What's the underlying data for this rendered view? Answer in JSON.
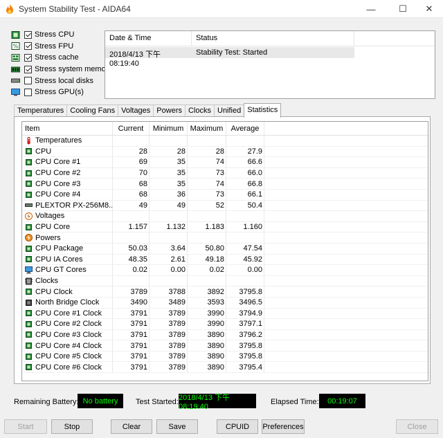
{
  "window": {
    "title": "System Stability Test - AIDA64",
    "min_symbol": "—",
    "max_symbol": "☐",
    "close_symbol": "✕"
  },
  "options": [
    {
      "label": "Stress CPU",
      "checked": true,
      "icon": "cpu-icon"
    },
    {
      "label": "Stress FPU",
      "checked": true,
      "icon": "fpu-icon"
    },
    {
      "label": "Stress cache",
      "checked": true,
      "icon": "cache-icon"
    },
    {
      "label": "Stress system memory",
      "checked": true,
      "icon": "memory-icon"
    },
    {
      "label": "Stress local disks",
      "checked": false,
      "icon": "disk-icon"
    },
    {
      "label": "Stress GPU(s)",
      "checked": false,
      "icon": "gpu-icon"
    }
  ],
  "log": {
    "col_datetime": "Date & Time",
    "col_status": "Status",
    "rows": [
      {
        "datetime": "2018/4/13 下午 08:19:40",
        "status": "Stability Test: Started"
      }
    ]
  },
  "tabs": [
    "Temperatures",
    "Cooling Fans",
    "Voltages",
    "Powers",
    "Clocks",
    "Unified",
    "Statistics"
  ],
  "active_tab": "Statistics",
  "stats": {
    "headers": {
      "item": "Item",
      "current": "Current",
      "minimum": "Minimum",
      "maximum": "Maximum",
      "average": "Average"
    },
    "rows": [
      {
        "type": "cat",
        "icon": "thermometer-icon",
        "item": "Temperatures"
      },
      {
        "type": "sub",
        "icon": "cpu-chip-icon",
        "item": "CPU",
        "current": "28",
        "minimum": "28",
        "maximum": "28",
        "average": "27.9"
      },
      {
        "type": "sub",
        "icon": "cpu-chip-icon",
        "item": "CPU Core #1",
        "current": "69",
        "minimum": "35",
        "maximum": "74",
        "average": "66.6"
      },
      {
        "type": "sub",
        "icon": "cpu-chip-icon",
        "item": "CPU Core #2",
        "current": "70",
        "minimum": "35",
        "maximum": "73",
        "average": "66.0"
      },
      {
        "type": "sub",
        "icon": "cpu-chip-icon",
        "item": "CPU Core #3",
        "current": "68",
        "minimum": "35",
        "maximum": "74",
        "average": "66.8"
      },
      {
        "type": "sub",
        "icon": "cpu-chip-icon",
        "item": "CPU Core #4",
        "current": "68",
        "minimum": "36",
        "maximum": "73",
        "average": "66.1"
      },
      {
        "type": "sub",
        "icon": "drive-icon",
        "item": "PLEXTOR PX-256M8...",
        "current": "49",
        "minimum": "49",
        "maximum": "52",
        "average": "50.4"
      },
      {
        "type": "cat",
        "icon": "voltage-icon",
        "item": "Voltages"
      },
      {
        "type": "sub",
        "icon": "cpu-chip-icon",
        "item": "CPU Core",
        "current": "1.157",
        "minimum": "1.132",
        "maximum": "1.183",
        "average": "1.160"
      },
      {
        "type": "cat",
        "icon": "power-icon",
        "item": "Powers"
      },
      {
        "type": "sub",
        "icon": "cpu-chip-icon",
        "item": "CPU Package",
        "current": "50.03",
        "minimum": "3.64",
        "maximum": "50.80",
        "average": "47.54"
      },
      {
        "type": "sub",
        "icon": "cpu-chip-icon",
        "item": "CPU IA Cores",
        "current": "48.35",
        "minimum": "2.61",
        "maximum": "49.18",
        "average": "45.92"
      },
      {
        "type": "sub",
        "icon": "monitor-icon",
        "item": "CPU GT Cores",
        "current": "0.02",
        "minimum": "0.00",
        "maximum": "0.02",
        "average": "0.00"
      },
      {
        "type": "cat",
        "icon": "clock-icon",
        "item": "Clocks"
      },
      {
        "type": "sub",
        "icon": "cpu-chip-icon",
        "item": "CPU Clock",
        "current": "3789",
        "minimum": "3788",
        "maximum": "3892",
        "average": "3795.8"
      },
      {
        "type": "sub",
        "icon": "chipset-icon",
        "item": "North Bridge Clock",
        "current": "3490",
        "minimum": "3489",
        "maximum": "3593",
        "average": "3496.5"
      },
      {
        "type": "sub",
        "icon": "cpu-chip-icon",
        "item": "CPU Core #1 Clock",
        "current": "3791",
        "minimum": "3789",
        "maximum": "3990",
        "average": "3794.9"
      },
      {
        "type": "sub",
        "icon": "cpu-chip-icon",
        "item": "CPU Core #2 Clock",
        "current": "3791",
        "minimum": "3789",
        "maximum": "3990",
        "average": "3797.1"
      },
      {
        "type": "sub",
        "icon": "cpu-chip-icon",
        "item": "CPU Core #3 Clock",
        "current": "3791",
        "minimum": "3789",
        "maximum": "3890",
        "average": "3796.2"
      },
      {
        "type": "sub",
        "icon": "cpu-chip-icon",
        "item": "CPU Core #4 Clock",
        "current": "3791",
        "minimum": "3789",
        "maximum": "3890",
        "average": "3795.8"
      },
      {
        "type": "sub",
        "icon": "cpu-chip-icon",
        "item": "CPU Core #5 Clock",
        "current": "3791",
        "minimum": "3789",
        "maximum": "3890",
        "average": "3795.8"
      },
      {
        "type": "sub",
        "icon": "cpu-chip-icon",
        "item": "CPU Core #6 Clock",
        "current": "3791",
        "minimum": "3789",
        "maximum": "3890",
        "average": "3795.4"
      }
    ]
  },
  "status": {
    "battery_label": "Remaining Battery:",
    "battery_value": "No battery",
    "started_label": "Test Started:",
    "started_value": "2018/4/13 下午 08:19:40",
    "elapsed_label": "Elapsed Time:",
    "elapsed_value": "00:19:07"
  },
  "buttons": {
    "start": "Start",
    "stop": "Stop",
    "clear": "Clear",
    "save": "Save",
    "cpuid": "CPUID",
    "preferences": "Preferences",
    "close": "Close"
  },
  "colors": {
    "status_text": "#00ff00",
    "chip_green": "#1a7a2a",
    "thermo_red": "#cc2020",
    "power_orange": "#e07010"
  }
}
